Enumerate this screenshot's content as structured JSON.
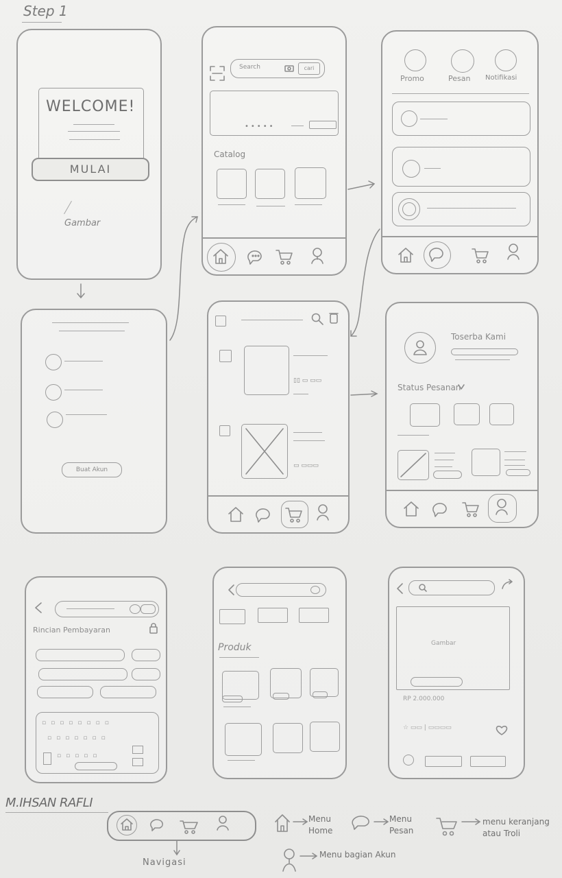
{
  "step_title": "Step 1",
  "screens": {
    "welcome": {
      "heading": "WELCOME!",
      "start_button": "MULAI",
      "image_label": "Gambar"
    },
    "onboarding": {
      "button": "Buat Akun"
    },
    "home": {
      "search_placeholder": "Search",
      "search_button": "cari",
      "section": "Catalog"
    },
    "messages": {
      "tabs": [
        "Promo",
        "Pesan",
        "Notifikasi"
      ]
    },
    "profile": {
      "store_name": "Toserba Kami",
      "status_label": "Status Pesanan"
    },
    "checkout": {
      "header": "Rincian Pembayaran"
    },
    "catalog": {
      "section": "Produk"
    },
    "detail": {
      "image_label": "Gambar",
      "price": "RP 2.000.000"
    }
  },
  "legend": {
    "author": "M.IHSAN RAFLI",
    "nav_caption": "Navigasi",
    "items": [
      {
        "icon": "home-icon",
        "label": "Menu Home"
      },
      {
        "icon": "chat-icon",
        "label": "Menu Pesan"
      },
      {
        "icon": "cart-icon",
        "label": "menu keranjang atau Troli"
      },
      {
        "icon": "user-icon",
        "label": "Menu bagian Akun"
      }
    ]
  }
}
